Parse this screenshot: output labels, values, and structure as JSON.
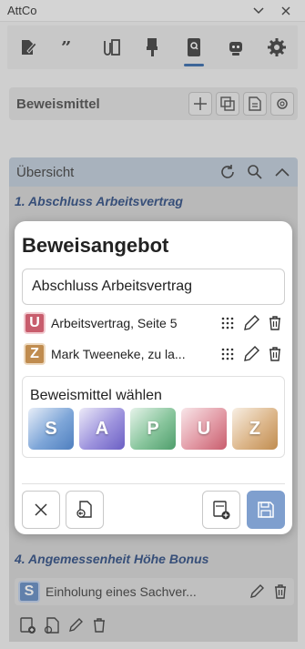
{
  "window": {
    "title": "AttCo"
  },
  "toolbar": {
    "tools": [
      {
        "icon": "pencil-document-icon"
      },
      {
        "icon": "quote-icon"
      },
      {
        "icon": "paperclip-documents-icon"
      },
      {
        "icon": "brush-icon"
      },
      {
        "icon": "book-search-icon",
        "active": true
      },
      {
        "icon": "robot-icon"
      },
      {
        "icon": "gear-icon"
      }
    ]
  },
  "section": {
    "title": "Beweismittel"
  },
  "overview": {
    "title": "Übersicht"
  },
  "background_items": [
    {
      "title": "1. Abschluss Arbeitsvertrag"
    },
    {
      "title": "4. Angemessenheit Höhe Bonus"
    }
  ],
  "background_row": {
    "badge": "S",
    "text": "Einholung eines Sachver..."
  },
  "modal": {
    "title": "Beweisangebot",
    "topic": "Abschluss Arbeitsvertrag",
    "evidence": [
      {
        "badge": "U",
        "color": "#c85d6d",
        "text": "Arbeitsvertrag, Seite 5"
      },
      {
        "badge": "Z",
        "color": "#c08c4f",
        "text": "Mark Tweeneke, zu la..."
      }
    ],
    "chooser_label": "Beweismittel wählen",
    "tiles": [
      "S",
      "A",
      "P",
      "U",
      "Z"
    ]
  },
  "colors": {
    "accent": "#2a5fa3",
    "save_button": "#7f9fce",
    "item_title": "#22427a"
  }
}
